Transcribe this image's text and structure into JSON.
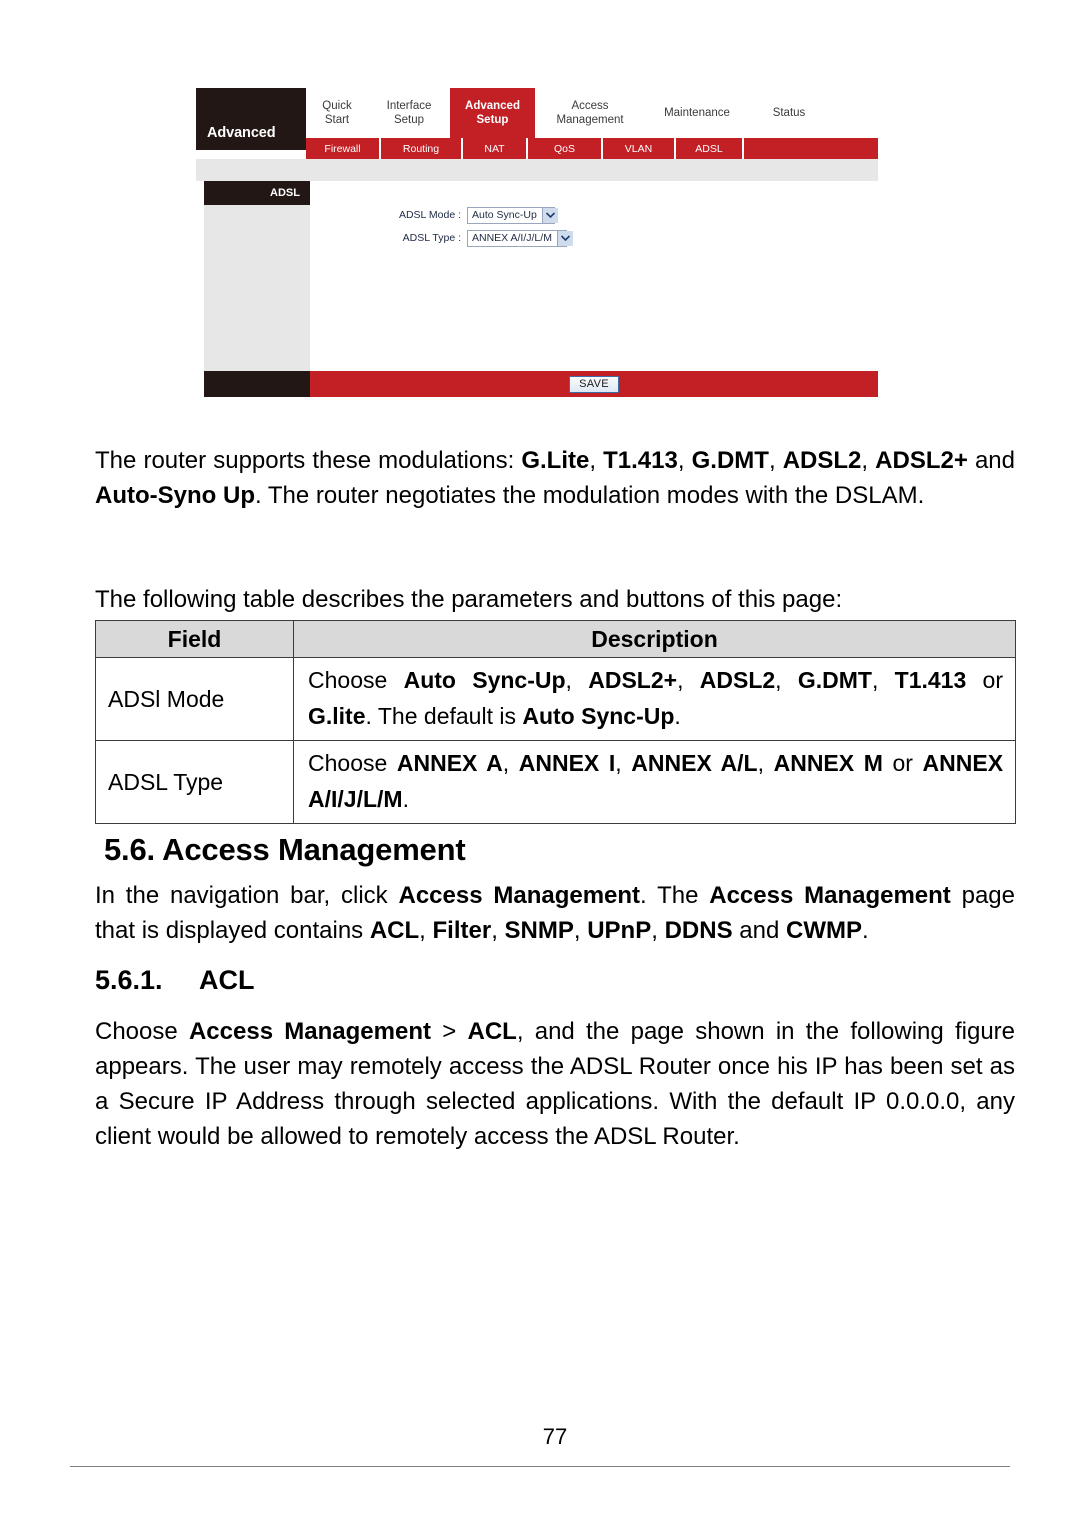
{
  "figure": {
    "brand_label": "Advanced",
    "main_tabs": [
      {
        "label": "Quick\nStart",
        "active": false
      },
      {
        "label": "Interface\nSetup",
        "active": false
      },
      {
        "label": "Advanced\nSetup",
        "active": true
      },
      {
        "label": "Access\nManagement",
        "active": false
      },
      {
        "label": "Maintenance",
        "active": false
      },
      {
        "label": "Status",
        "active": false
      }
    ],
    "sub_tabs": [
      {
        "label": "Firewall"
      },
      {
        "label": "Routing"
      },
      {
        "label": "NAT"
      },
      {
        "label": "QoS"
      },
      {
        "label": "VLAN"
      },
      {
        "label": "ADSL"
      }
    ],
    "sidebar_title": "ADSL",
    "form": {
      "mode_label": "ADSL Mode :",
      "mode_value": "Auto Sync-Up",
      "type_label": "ADSL Type :",
      "type_value": "ANNEX A/I/J/L/M"
    },
    "save_label": "SAVE",
    "colors": {
      "red": "#c32026",
      "dark": "#231715",
      "gray": "#e7e7e7"
    }
  },
  "body": {
    "para_modulations": {
      "s1": "The router supports these modulations: ",
      "b1": "G.Lite",
      "s2": ", ",
      "b2": "T1.413",
      "s3": ", ",
      "b3": "G.DMT",
      "s4": ", ",
      "b4": "ADSL2",
      "s5": ", ",
      "b5": "ADSL2+",
      "s6": " and ",
      "b6": "Auto-Syno Up",
      "s7": ". The router negotiates the modulation modes with the DSLAM."
    },
    "para_table_intro": "The following table describes the parameters and buttons of this page:",
    "table": {
      "headers": [
        "Field",
        "Description"
      ],
      "rows": [
        {
          "field": "ADSl Mode",
          "desc": {
            "s1": "Choose ",
            "b1": "Auto Sync-Up",
            "s2": ", ",
            "b2": "ADSL2+",
            "s3": ", ",
            "b3": "ADSL2",
            "s4": ", ",
            "b4": "G.DMT",
            "s5": ", ",
            "b5": "T1.413",
            "s6": " or ",
            "b6": "G.lite",
            "s7": ". The default is ",
            "b7": "Auto Sync-Up",
            "s8": "."
          }
        },
        {
          "field": "ADSL Type",
          "desc": {
            "s1": "Choose ",
            "b1": "ANNEX A",
            "s2": ", ",
            "b2": "ANNEX I",
            "s3": ", ",
            "b3": "ANNEX A/L",
            "s4": ", ",
            "b4": "ANNEX M",
            "s5": " or ",
            "b5": "ANNEX A/I/J/L/M",
            "s6": "."
          }
        }
      ]
    },
    "heading_section": "5.6. Access Management",
    "para_access_mgmt": {
      "s1": "In the navigation bar, click ",
      "b1": "Access Management",
      "s2": ". The ",
      "b2": "Access Management",
      "s3": " page that is displayed contains ",
      "b3": "ACL",
      "s4": ", ",
      "b4": "Filter",
      "s5": ", ",
      "b5": "SNMP",
      "s6": ", ",
      "b6": "UPnP",
      "s7": ", ",
      "b7": "DDNS",
      "s8": " and ",
      "b8": "CWMP",
      "s9": "."
    },
    "heading_sub_number": "5.6.1.",
    "heading_sub_title": "ACL",
    "para_acl": {
      "s1": "Choose ",
      "b1": "Access Management",
      "s2": " > ",
      "b2": "ACL",
      "s3": ", and the page shown in the following figure appears. The user may remotely access the ADSL Router once his IP has been set as a Secure IP Address through selected applications. With the default IP 0.0.0.0, any client would be allowed to remotely access the ADSL Router."
    }
  },
  "footer": {
    "page_number": "77"
  }
}
